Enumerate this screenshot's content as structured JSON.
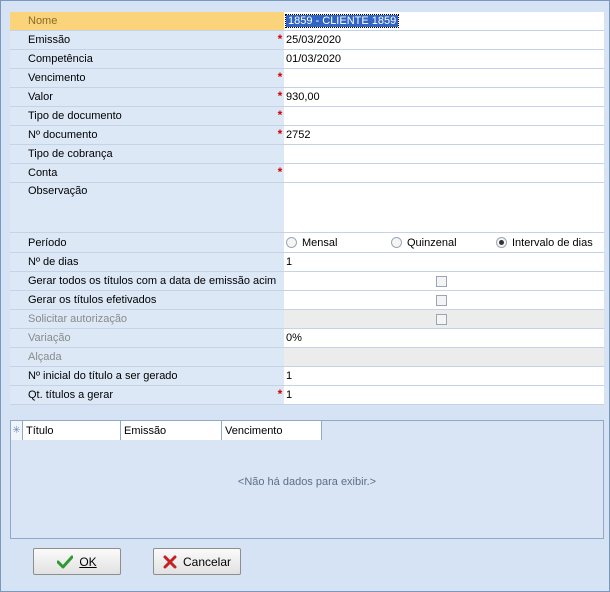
{
  "form": {
    "nome_label": "Nome",
    "nome_value": "1859 - CLIENTE  1859",
    "emissao_label": "Emissão",
    "emissao_value": "25/03/2020",
    "competencia_label": "Competência",
    "competencia_value": "01/03/2020",
    "vencimento_label": "Vencimento",
    "vencimento_value": "",
    "valor_label": "Valor",
    "valor_value": "930,00",
    "tipo_documento_label": "Tipo de documento",
    "tipo_documento_value": "",
    "numero_documento_label": "Nº documento",
    "numero_documento_value": "2752",
    "tipo_cobranca_label": "Tipo de cobrança",
    "tipo_cobranca_value": "",
    "conta_label": "Conta",
    "conta_value": "",
    "observacao_label": "Observação",
    "observacao_value": "",
    "periodo_label": "Período",
    "periodo_options": [
      "Mensal",
      "Quinzenal",
      "Intervalo de dias"
    ],
    "periodo_selected": "Intervalo de dias",
    "num_dias_label": "Nº de dias",
    "num_dias_value": "1",
    "gerar_todos_label": "Gerar todos os títulos com a data de emissão acima",
    "gerar_todos_checked": false,
    "gerar_efetivados_label": "Gerar os títulos efetivados",
    "gerar_efetivados_checked": false,
    "solicitar_autorizacao_label": "Solicitar autorização",
    "solicitar_autorizacao_checked": false,
    "variacao_label": "Variação",
    "variacao_value": "0%",
    "alcada_label": "Alçada",
    "alcada_value": "",
    "numero_inicial_label": "Nº inicial do título a ser gerado",
    "numero_inicial_value": "1",
    "qt_titulos_label": "Qt. títulos a gerar",
    "qt_titulos_value": "1",
    "required_marker": "*"
  },
  "titles_grid": {
    "columns": [
      "Título",
      "Emissão",
      "Vencimento"
    ],
    "indicator": "✳",
    "empty_message": "<Não há dados para exibir.>"
  },
  "buttons": {
    "ok_label": "OK",
    "cancel_label": "Cancelar"
  },
  "colors": {
    "focus_row": "#fad37a",
    "required": "#d00000",
    "selection": "#2f63c4"
  }
}
